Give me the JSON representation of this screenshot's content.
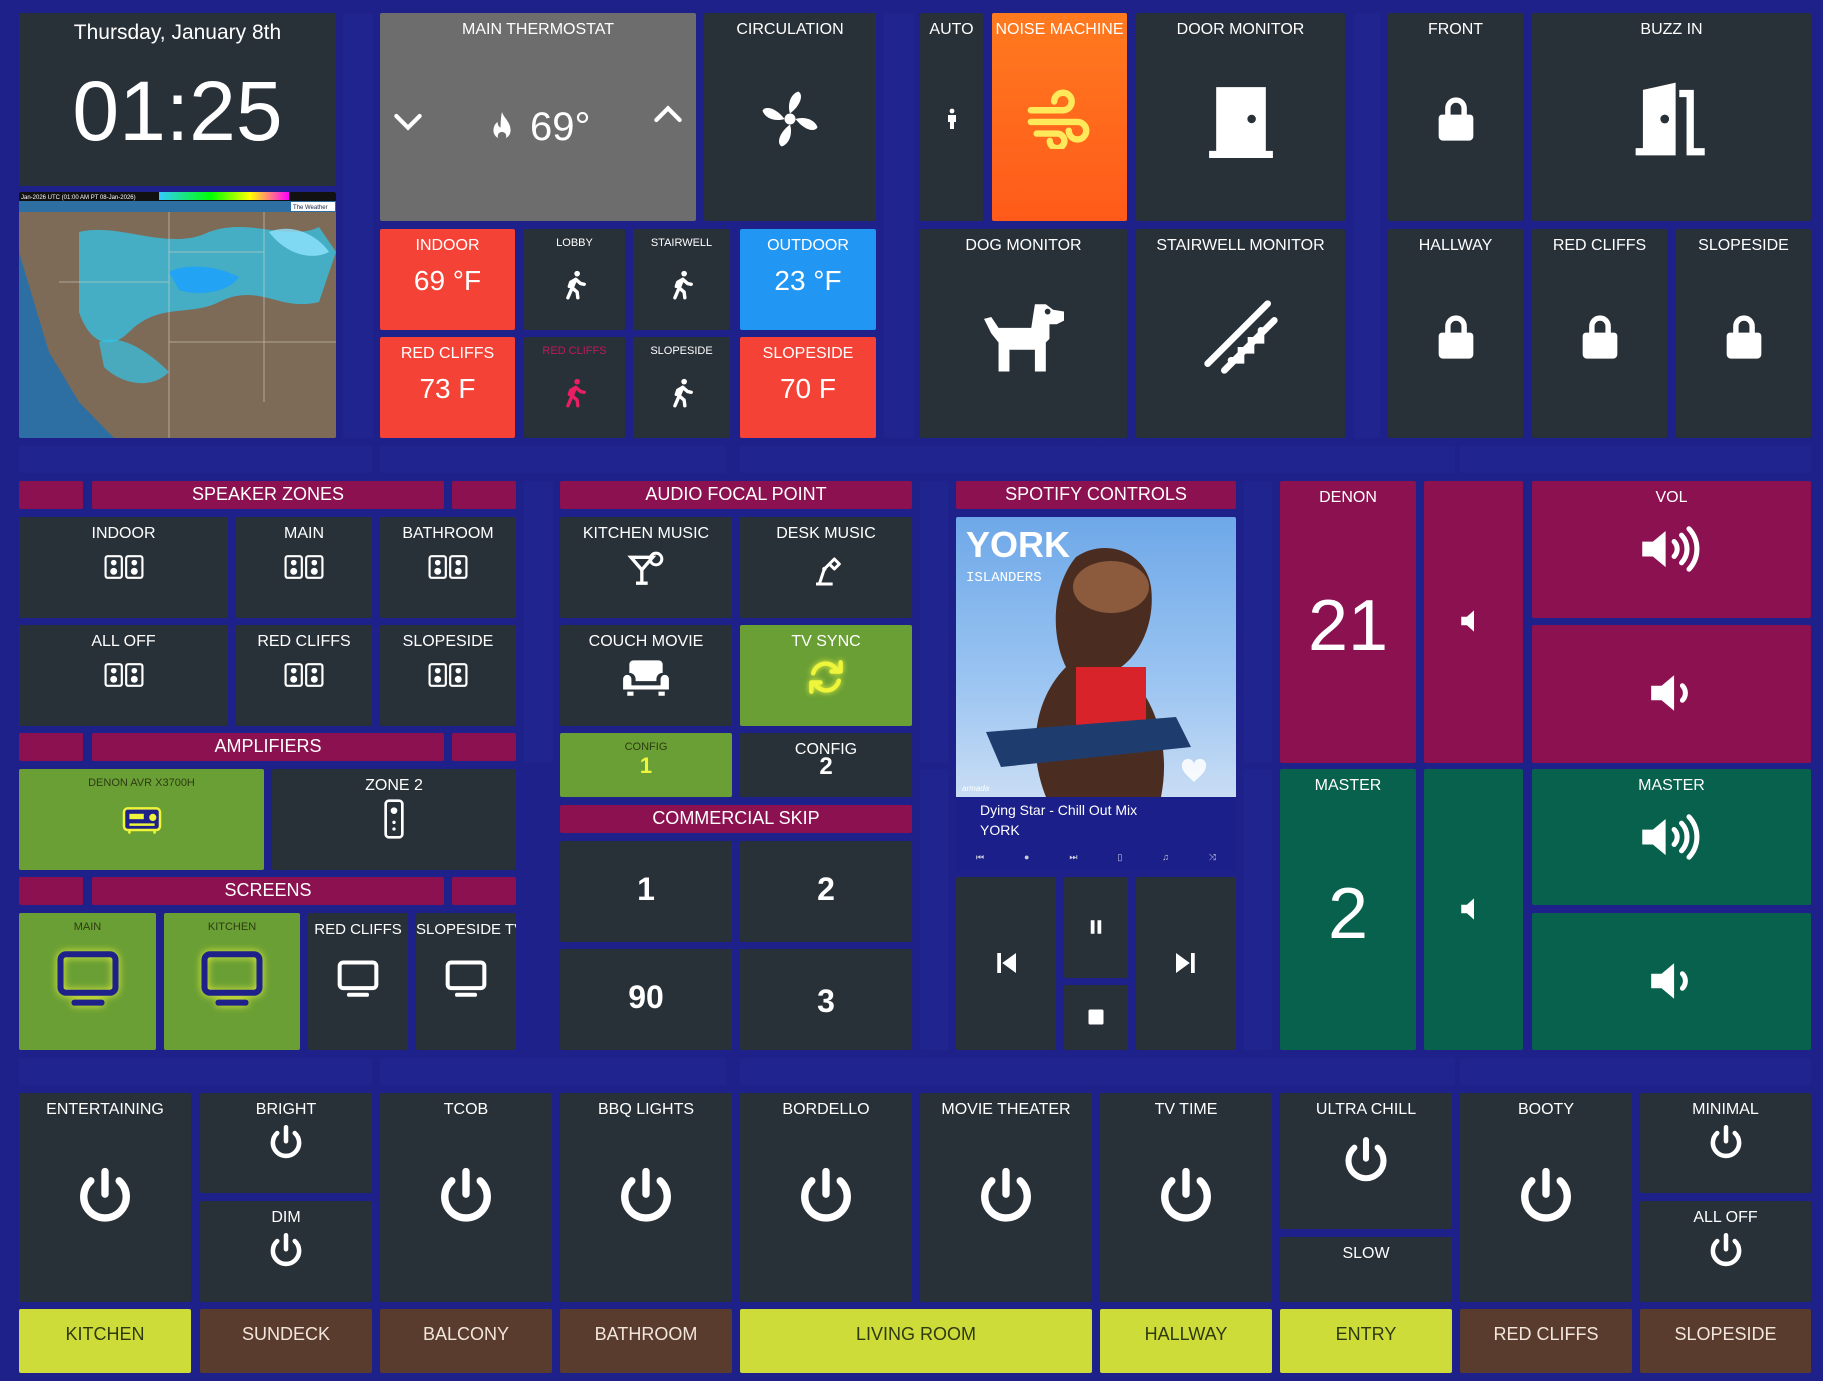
{
  "clock": {
    "date": "Thursday, January 8th",
    "time": "01:25"
  },
  "radar": {
    "banner": "Jan-2026 UTC  (01:00 AM PT 08-Jan-2026)",
    "credit": "The Weather"
  },
  "thermostat": {
    "label": "MAIN THERMOSTAT",
    "temp": "69°"
  },
  "circulation": {
    "label": "CIRCULATION"
  },
  "auto": {
    "label": "AUTO"
  },
  "noise_machine": {
    "label": "NOISE MACHINE"
  },
  "door_monitor": {
    "label": "DOOR MONITOR"
  },
  "front": {
    "label": "FRONT"
  },
  "buzz_in": {
    "label": "BUZZ IN"
  },
  "temps": {
    "indoor": {
      "label": "INDOOR",
      "value": "69 °F"
    },
    "outdoor": {
      "label": "OUTDOOR",
      "value": "23 °F"
    },
    "red_cliffs": {
      "label": "RED CLIFFS",
      "value": "73 F"
    },
    "slopeside": {
      "label": "SLOPESIDE",
      "value": "70 F"
    }
  },
  "motion": {
    "lobby": "LOBBY",
    "stairwell": "STAIRWELL",
    "red_cliffs": "RED CLIFFS",
    "slopeside": "SLOPESIDE"
  },
  "dog_monitor": {
    "label": "DOG MONITOR"
  },
  "stairwell_monitor": {
    "label": "STAIRWELL MONITOR"
  },
  "locks": {
    "hallway": "HALLWAY",
    "red_cliffs": "RED CLIFFS",
    "slopeside": "SLOPESIDE"
  },
  "speaker_zones": {
    "header": "SPEAKER ZONES",
    "items": [
      "INDOOR",
      "MAIN",
      "BATHROOM",
      "ALL OFF",
      "RED CLIFFS",
      "SLOPESIDE"
    ]
  },
  "amplifiers": {
    "header": "AMPLIFIERS",
    "denon": "DENON AVR X3700H",
    "zone2": "ZONE 2"
  },
  "screens": {
    "header": "SCREENS",
    "main": "MAIN",
    "kitchen": "KITCHEN",
    "red_cliffs": "RED CLIFFS",
    "slopeside": "SLOPESIDE TV"
  },
  "audio_focal": {
    "header": "AUDIO FOCAL POINT",
    "kitchen_music": "KITCHEN MUSIC",
    "desk_music": "DESK MUSIC",
    "couch_movie": "COUCH MOVIE",
    "tv_sync": "TV SYNC",
    "config1_label": "CONFIG",
    "config1_value": "1",
    "config2_label": "CONFIG",
    "config2_value": "2"
  },
  "commercial_skip": {
    "header": "COMMERCIAL SKIP",
    "values": [
      "1",
      "2",
      "90",
      "3"
    ]
  },
  "spotify": {
    "header": "SPOTIFY CONTROLS",
    "album_artist": "YORK",
    "album_title": "ISLANDERS",
    "album_label": "armada",
    "track": "Dying Star - Chill Out Mix",
    "artist": "YORK"
  },
  "denon": {
    "label": "DENON",
    "value": "21",
    "vol_label": "VOL"
  },
  "master": {
    "label": "MASTER",
    "value": "2",
    "vol_label": "MASTER"
  },
  "scenes": {
    "entertaining": "ENTERTAINING",
    "bright": "BRIGHT",
    "dim": "DIM",
    "tcob": "TCOB",
    "bbq": "BBQ LIGHTS",
    "bordello": "BORDELLO",
    "movie": "MOVIE THEATER",
    "tvtime": "TV TIME",
    "ultra": "ULTRA CHILL",
    "slow": "SLOW",
    "booty": "BOOTY",
    "minimal": "MINIMAL",
    "alloff": "ALL OFF"
  },
  "rooms": [
    "KITCHEN",
    "SUNDECK",
    "BALCONY",
    "BATHROOM",
    "LIVING ROOM",
    "HALLWAY",
    "ENTRY",
    "RED CLIFFS",
    "SLOPESIDE"
  ],
  "colors": {
    "background": "#1e2189",
    "tile": "#283038",
    "alert_red": "#f44336",
    "outdoor_blue": "#2196f3",
    "active_green": "#6a9f35",
    "room_on": "#cedc3a",
    "room_off": "#5a3c2e",
    "denon_magenta": "#8c1150",
    "master_teal": "#07614c",
    "noise_orange": "#ff6a1f",
    "glow_yellow": "#eef53a"
  }
}
